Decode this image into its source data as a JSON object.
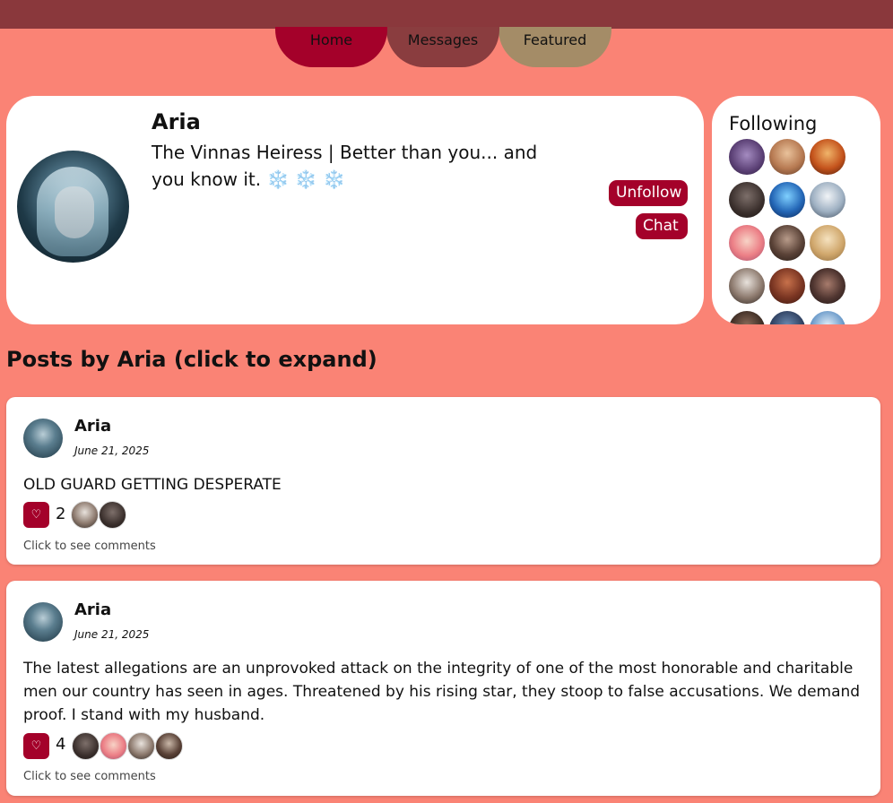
{
  "nav": {
    "tabs": [
      {
        "label": "Home",
        "color": "#A4012A"
      },
      {
        "label": "Messages",
        "color": "#8A3D3F"
      },
      {
        "label": "Featured",
        "color": "#A48C67"
      }
    ]
  },
  "profile": {
    "name": "Aria",
    "bio": "The Vinnas Heiress | Better than you... and you know it.",
    "bio_emoji": "❄️ ❄️ ❄️",
    "unfollow_label": "Unfollow",
    "chat_label": "Chat"
  },
  "following": {
    "title": "Following"
  },
  "posts_section": {
    "title": "Posts by Aria (click to expand)"
  },
  "posts": [
    {
      "author": "Aria",
      "date": "June 21, 2025",
      "content": "OLD GUARD GETTING DESPERATE",
      "likes": "2",
      "comments_label": "Click to see comments"
    },
    {
      "author": "Aria",
      "date": "June 21, 2025",
      "content": "The latest allegations are an unprovoked attack on the integrity of one of the most honorable and charitable men our country has seen in ages. Threatened by his rising star, they stoop to false accusations. We demand proof. I stand with my husband.",
      "likes": "4",
      "comments_label": "Click to see comments"
    }
  ],
  "icons": {
    "like": "heart-icon"
  },
  "colors": {
    "background": "#FA8375",
    "topbar": "#8A383C",
    "accent": "#A4012A"
  }
}
